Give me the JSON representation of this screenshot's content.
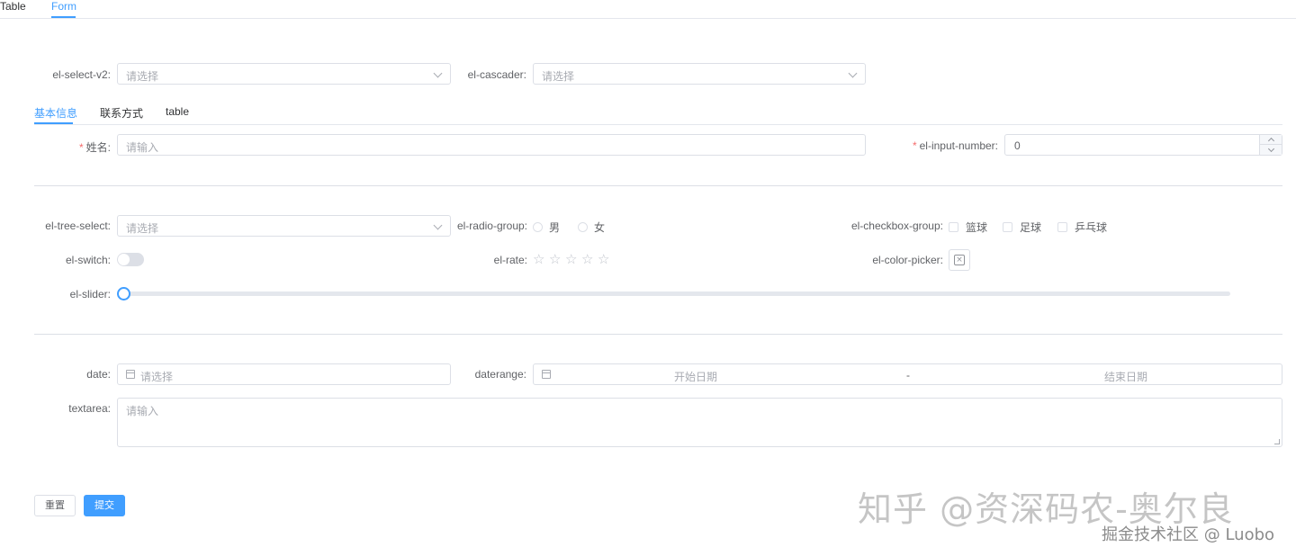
{
  "top_tabs": [
    "Table",
    "Form"
  ],
  "row1": {
    "select_v2": {
      "label": "el-select-v2:",
      "placeholder": "请选择"
    },
    "cascader": {
      "label": "el-cascader:",
      "placeholder": "请选择"
    }
  },
  "inner_tabs": [
    "基本信息",
    "联系方式",
    "table"
  ],
  "name_field": {
    "required": "*",
    "label": "姓名:",
    "placeholder": "请输入"
  },
  "input_number": {
    "required": "*",
    "label": "el-input-number:",
    "value": "0"
  },
  "tree_select": {
    "label": "el-tree-select:",
    "placeholder": "请选择"
  },
  "radio_group": {
    "label": "el-radio-group:",
    "options": [
      "男",
      "女"
    ]
  },
  "checkbox_group": {
    "label": "el-checkbox-group:",
    "options": [
      "篮球",
      "足球",
      "乒乓球"
    ]
  },
  "switch": {
    "label": "el-switch:",
    "value": false
  },
  "rate": {
    "label": "el-rate:",
    "value": 0,
    "max": 5
  },
  "color_picker": {
    "label": "el-color-picker:",
    "glyph": "×"
  },
  "slider": {
    "label": "el-slider:",
    "value": 0
  },
  "date": {
    "label": "date:",
    "placeholder": "请选择"
  },
  "daterange": {
    "label": "daterange:",
    "start_placeholder": "开始日期",
    "separator": "-",
    "end_placeholder": "结束日期"
  },
  "textarea": {
    "label": "textarea:",
    "placeholder": "请输入"
  },
  "buttons": {
    "reset": "重置",
    "submit": "提交"
  },
  "watermark": {
    "line1": "知乎 @资深码农-奥尔良",
    "line2": "掘金技术社区 @ Luobo"
  },
  "colors": {
    "primary": "#409eff",
    "border": "#dcdfe6",
    "required": "#f56c6c",
    "placeholder": "#a8abb2"
  }
}
